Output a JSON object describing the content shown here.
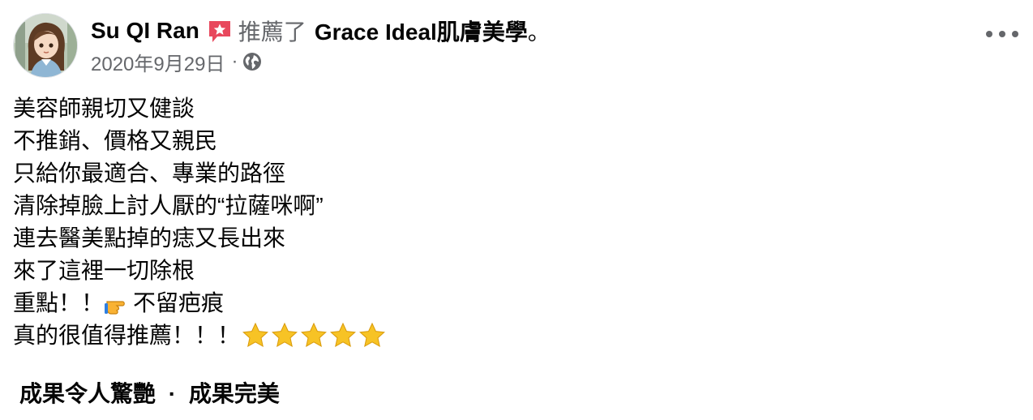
{
  "post": {
    "author": "Su QI Ran",
    "rec_verb": "推薦了",
    "page_name": "Grace Ideal肌膚美學",
    "period": "。",
    "date": "2020年9月29日",
    "meta_separator": "·",
    "privacy_icon": "globe-icon",
    "menu_icon": "more-dots-icon",
    "recommend_icon": "recommend-badge-icon",
    "body_lines": [
      "美容師親切又健談",
      "不推銷、價格又親民",
      "只給你最適合、專業的路徑",
      "清除掉臉上討人厭的“拉薩咪啊”",
      "連去醫美點掉的痣又長出來",
      "來了這裡一切除根"
    ],
    "line7_before": "重點！！",
    "line7_emoji": "backhand-pointing-right-emoji",
    "line7_after": "不留疤痕",
    "line8_text": "真的很值得推薦！！！",
    "star_icon": "star-emoji",
    "star_count": 5,
    "tags": [
      "成果令人驚艷",
      "成果完美"
    ],
    "tag_separator": "·"
  },
  "colors": {
    "text_primary": "#050505",
    "text_secondary": "#65676b",
    "recommend_badge": "#e8485d",
    "star": "#f7c325"
  }
}
